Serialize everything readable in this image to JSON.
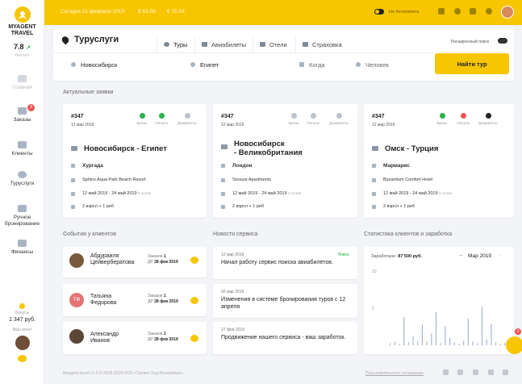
{
  "sidebar": {
    "brand_line1": "MYAGENT",
    "brand_line2": "TRAVEL",
    "rating_value": "7.8",
    "rating_trend": "↗",
    "rating_label": "Рейтинг",
    "items": [
      {
        "label": "Главная"
      },
      {
        "label": "Заказы",
        "badge": "3"
      },
      {
        "label": "Клиенты"
      },
      {
        "label": "Турусл​уги"
      },
      {
        "label": "Ручное бронирование"
      },
      {
        "label": "Финансы"
      }
    ],
    "bonus_label": "Бонусы",
    "bonus_value": "1 347 руб.",
    "manager_label": "Ваш агент"
  },
  "topbar": {
    "date": "Сегодня 21 февраля 2019",
    "usd": "$ 63.58",
    "eur": "€ 75.03",
    "dnd_label": "Не беспокоить"
  },
  "page": {
    "title": "Турусл​уги",
    "tabs": [
      "Туры",
      "Авиабилеты",
      "Отели",
      "Страховка"
    ],
    "advanced_search": "Расширенный поиск"
  },
  "search": {
    "from": "Новосибирск",
    "to": "Египет",
    "when_placeholder": "Когда",
    "people": "Человек",
    "button": "Найти тур"
  },
  "requests_title": "Актуальные заявки",
  "status_labels": [
    "Бронь",
    "Оплата",
    "Документы"
  ],
  "requests": [
    {
      "id": "#347",
      "date": "12 мар 2019",
      "route_line1": "Новосибирск - Египет",
      "route_line2": "",
      "city": "Хургада",
      "hotel": "Sphinx Aqua Park Beach Resort",
      "dates": "12 май 2019 - 24 май 2019",
      "nights": "9 ночей",
      "people": "2 взрсл + 1 реб"
    },
    {
      "id": "#347",
      "date": "12 мар 2019",
      "route_line1": "Новосибирск",
      "route_line2": "- Великобритания",
      "city": "Лондон",
      "hotel": "Snooze Apartments",
      "dates": "12 май 2019 - 24 май 2019",
      "nights": "9 ночей",
      "people": "2 взрсл + 1 реб"
    },
    {
      "id": "#347",
      "date": "12 мар 2019",
      "route_line1": "Омск - Турция",
      "route_line2": "",
      "city": "Мармарис",
      "hotel": "Byzantium Comfort Hotel",
      "dates": "12 май 2019 - 24 май 2019",
      "nights": "9 ночей",
      "people": "2 взрсл + 1 реб"
    }
  ],
  "events_title": "События у клиентов",
  "clients": [
    {
      "name1": "Абдураиля",
      "name2": "Цейвербератова",
      "orders_label": "Заказов",
      "orders": "1",
      "dr_label": "ДР",
      "dr": "28 фев 2019",
      "initials": ""
    },
    {
      "name1": "Татьяна",
      "name2": "Федорова",
      "orders_label": "Заказов",
      "orders": "1",
      "dr_label": "ДР",
      "dr": "28 фев 2019",
      "initials": "ТФ"
    },
    {
      "name1": "Александр",
      "name2": "Иванов",
      "orders_label": "Заказов",
      "orders": "1",
      "dr_label": "ДР",
      "dr": "28 фев 2019",
      "initials": ""
    }
  ],
  "news_title": "Новости сервиса",
  "news": [
    {
      "date": "12 мар 2019",
      "text": "Начал работу сервис поиска авиабилетов.",
      "badge": "Новое"
    },
    {
      "date": "02 мар 2019",
      "text": "Изменения в системе бронирования туров с 12 апреля",
      "badge": ""
    },
    {
      "date": "27 фев 2019",
      "text": "Продвижение нашего сервиса - ваш заработок.",
      "badge": ""
    }
  ],
  "stats_title": "Статистика клиентов и заработка",
  "chart_data": {
    "type": "bar",
    "title": "",
    "earned_label": "Заработано:",
    "earned_value": "87 500 руб.",
    "period": "Мар 2019",
    "yticks": [
      "10",
      "5"
    ],
    "ylim": [
      0,
      10
    ],
    "values": [
      0.3,
      0.5,
      0.2,
      3.8,
      0.4,
      1.2,
      0.6,
      2.8,
      0.5,
      1.6,
      4.5,
      0.3,
      2.6,
      1.0,
      0.4,
      0.2,
      0.6,
      3.6,
      0.5,
      0.3,
      5.2,
      0.8,
      2.9,
      0.4,
      0.2,
      0.3
    ]
  },
  "footer": {
    "copyright": "Myagent.travel   v1.0  © 2018-2019 ООО «Тревел Ход Инновейшн»",
    "agreement": "Пользовательское соглашение"
  },
  "fab_badge": "2",
  "colors": {
    "accent": "#f7c600",
    "ok": "#2bb24c",
    "error": "#f05454"
  }
}
